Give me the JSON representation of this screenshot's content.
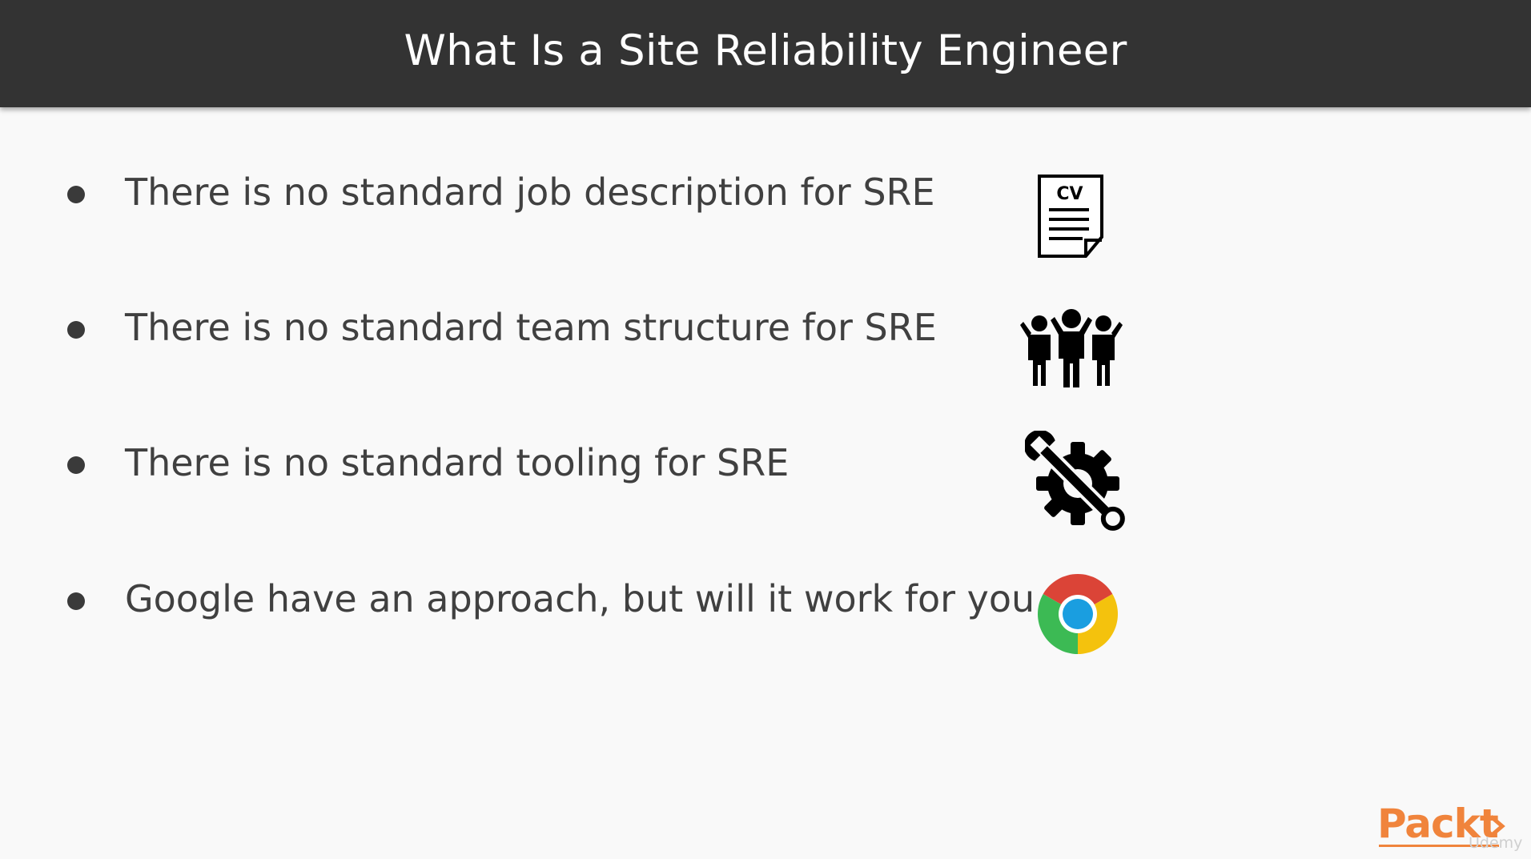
{
  "slide": {
    "title": "What Is a Site Reliability Engineer"
  },
  "bullets": [
    {
      "text": "There is no standard job description for SRE",
      "icon": "cv-document-icon",
      "icon_label": "CV"
    },
    {
      "text": "There is no standard team structure for SRE",
      "icon": "team-people-icon"
    },
    {
      "text": "There is no standard tooling for SRE",
      "icon": "gear-wrench-icon"
    },
    {
      "text": "Google have an approach, but will it work for you",
      "icon": "chrome-icon"
    }
  ],
  "branding": {
    "logo_text": "Packt",
    "watermark": "Udemy"
  },
  "colors": {
    "title_bar": "#333333",
    "background": "#f9f9f9",
    "text": "#404040",
    "brand_orange": "#f0843c",
    "chrome_red": "#db4437",
    "chrome_yellow": "#f4c20d",
    "chrome_green": "#3cba54",
    "chrome_blue": "#1a9ee0"
  }
}
